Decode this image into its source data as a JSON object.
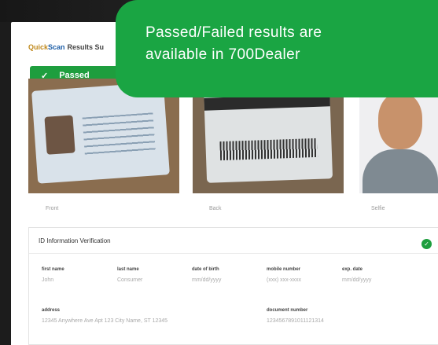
{
  "header": {
    "brand_quick": "Quick",
    "brand_scan": "Scan",
    "brand_tail": "Results Su"
  },
  "status": {
    "passed_label": "Passed",
    "check_glyph": "✓"
  },
  "callout": {
    "line1": "Passed/Failed results are",
    "line2": "available in 700Dealer"
  },
  "images": {
    "front_caption": "Front",
    "back_caption": "Back",
    "selfie_caption": "Selfie"
  },
  "verification": {
    "title": "ID Information Verification",
    "fields": [
      {
        "label": "first name",
        "value": "John"
      },
      {
        "label": "last name",
        "value": "Consumer"
      },
      {
        "label": "date of birth",
        "value": "mm/dd/yyyy"
      },
      {
        "label": "mobile number",
        "value": "(xxx) xxx-xxxx"
      },
      {
        "label": "exp. date",
        "value": "mm/dd/yyyy"
      },
      {
        "label": "address",
        "value": "12345 Anywhere Ave Apt 123 City Name, ST 12345"
      },
      {
        "label": "document number",
        "value": "1234567891011121314"
      }
    ]
  },
  "colors": {
    "accent_green": "#1e9e3e",
    "callout_green": "#1aa543"
  }
}
